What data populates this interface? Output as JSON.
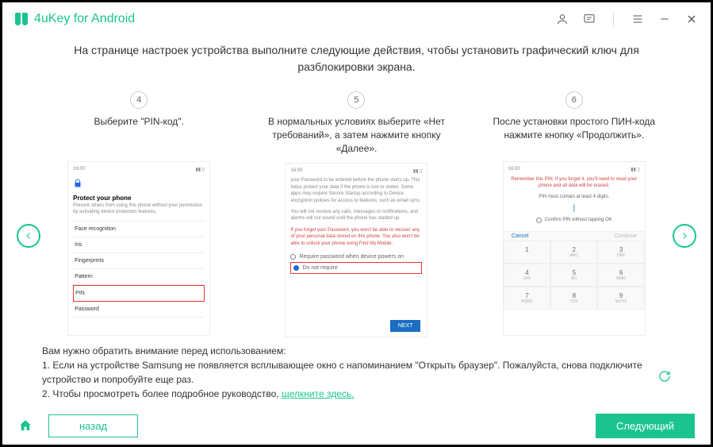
{
  "app_title": "4uKey for Android",
  "instruction": "На странице настроек устройства выполните следующие действия, чтобы установить графический ключ для разблокировки экрана.",
  "steps": [
    {
      "num": "4",
      "caption": "Выберите \"PIN-код\".",
      "phone": {
        "time": "16:00",
        "title": "Protect your phone",
        "desc": "Prevent others from using this phone without your permission by activating device protection features.",
        "options": [
          "Face recognition",
          "Iris",
          "Fingerprints",
          "Pattern",
          "PIN",
          "Password"
        ],
        "highlight_index": 4
      }
    },
    {
      "num": "5",
      "caption": "В нормальных условиях выберите «Нет требований», а затем нажмите кнопку «Далее».",
      "phone": {
        "time": "16:00",
        "text1": "your Password to be entered before the phone starts up. This helps protect your data if the phone is lost or stolen. Some apps may require Secure Startup according to Device encryption policies for access to features, such as email sync.",
        "text2": "You will not receive any calls, messages or notifications, and alarms will not sound until the phone has started up.",
        "text_red": "If you forget your Password, you won't be able to recover any of your personal data stored on this phone. You also won't be able to unlock your phone using Find My Mobile.",
        "opt1": "Require password when device powers on",
        "opt2": "Do not require",
        "next": "NEXT"
      }
    },
    {
      "num": "6",
      "caption": "После установки простого ПИН-кода нажмите кнопку «Продолжить».",
      "phone": {
        "time": "16:00",
        "warn": "Remember this PIN. If you forget it, you'll need to reset your phone and all data will be erased.",
        "info": "PIN must contain at least 4 digits.",
        "confirm": "Confirm PIN without tapping OK",
        "cancel": "Cancel",
        "continue": "Continue",
        "keys": [
          [
            "1",
            ""
          ],
          [
            "2",
            "ABC"
          ],
          [
            "3",
            "DEF"
          ],
          [
            "4",
            "GHI"
          ],
          [
            "5",
            "JKL"
          ],
          [
            "6",
            "MNO"
          ],
          [
            "7",
            "PQRS"
          ],
          [
            "8",
            "TUV"
          ],
          [
            "9",
            "WXYZ"
          ]
        ]
      }
    }
  ],
  "notes": {
    "heading": "Вам нужно обратить внимание перед использованием:",
    "line1": "1. Если на устройстве Samsung не появляется всплывающее окно с напоминанием \"Открыть браузер\". Пожалуйста, снова подключите устройство и попробуйте еще раз.",
    "line2_prefix": "2. Чтобы просмотреть более подробное руководство, ",
    "line2_link": "щелкните здесь."
  },
  "buttons": {
    "back": "назад",
    "next": "Следующий"
  }
}
